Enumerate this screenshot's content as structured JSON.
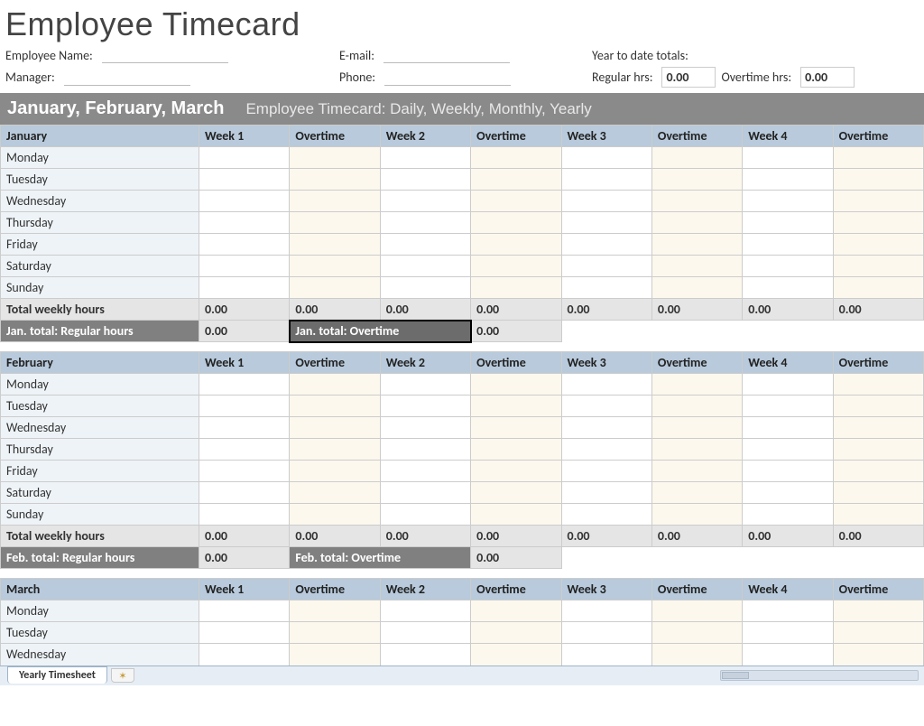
{
  "title": "Employee Timecard",
  "header": {
    "employee_name_label": "Employee Name:",
    "manager_label": "Manager:",
    "email_label": "E-mail:",
    "phone_label": "Phone:",
    "ytd_label": "Year to date totals:",
    "regular_hrs_label": "Regular hrs:",
    "regular_hrs_value": "0.00",
    "overtime_hrs_label": "Overtime hrs:",
    "overtime_hrs_value": "0.00"
  },
  "banner": {
    "months": "January, February, March",
    "subtitle": "Employee Timecard: Daily, Weekly, Monthly, Yearly"
  },
  "columns": [
    "Week 1",
    "Overtime",
    "Week 2",
    "Overtime",
    "Week 3",
    "Overtime",
    "Week 4",
    "Overtime"
  ],
  "days": [
    "Monday",
    "Tuesday",
    "Wednesday",
    "Thursday",
    "Friday",
    "Saturday",
    "Sunday"
  ],
  "totals_label": "Total weekly hours",
  "zero": "0.00",
  "months": {
    "jan": {
      "name": "January",
      "reg_total_label": "Jan. total: Regular hours",
      "ot_total_label": "Jan. total: Overtime"
    },
    "feb": {
      "name": "February",
      "reg_total_label": "Feb. total: Regular hours",
      "ot_total_label": "Feb.  total: Overtime"
    },
    "mar": {
      "name": "March"
    }
  },
  "march_visible_days": [
    "Monday",
    "Tuesday",
    "Wednesday"
  ],
  "tabbar": {
    "active_tab": "Yearly Timesheet"
  }
}
